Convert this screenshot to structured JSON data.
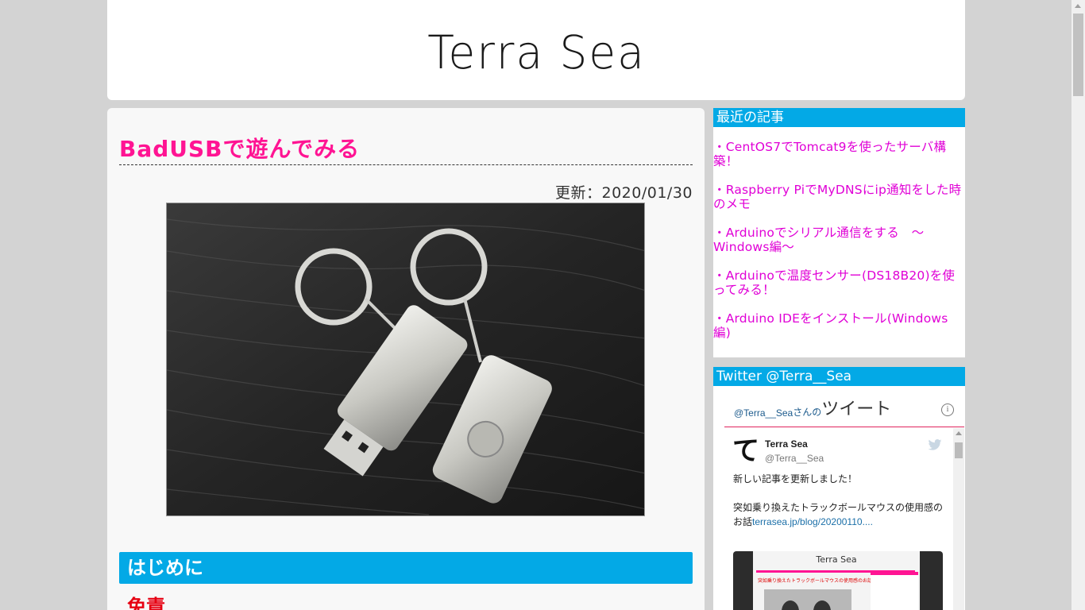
{
  "site": {
    "title": "Terra Sea"
  },
  "post": {
    "title": "BadUSBで遊んでみる",
    "updated": "更新：2020/01/30",
    "section_heading": "はじめに",
    "subheading": "免責"
  },
  "sidebar": {
    "recent_heading": "最近の記事",
    "recent_items": [
      "・CentOS7でTomcat9を使ったサーバ構築！",
      "・Raspberry PiでMyDNSにip通知をした時のメモ",
      "・Arduinoでシリアル通信をする　～Windows編～",
      "・Arduinoで温度センサー(DS18B20)を使ってみる！",
      "・Arduino IDEをインストール(Windows編)"
    ],
    "twitter_heading": "Twitter @Terra__Sea",
    "twitter": {
      "handle": "@Terra__Sea",
      "san": "さんの",
      "tweets": "ツイート",
      "info": "i",
      "avatar_char": "て",
      "name": "Terra Sea",
      "username": "@Terra__Sea",
      "text1": "新しい記事を更新しました！",
      "text2": "突如乗り換えたトラックボールマウスの使用感のお話",
      "link": "terrasea.jp/blog/20200110....",
      "preview_title": "Terra Sea",
      "preview_heading": "突如乗り換えたトラックボールマウスの使用感のお話"
    }
  },
  "colors": {
    "accent_blue": "#03a9e6",
    "title_pink": "#ff1493",
    "link_magenta": "#e000d6"
  }
}
